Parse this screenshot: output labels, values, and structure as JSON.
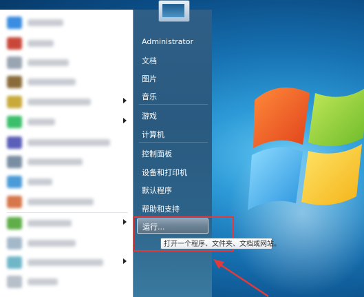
{
  "right_menu": {
    "user_name": "Administrator",
    "items": [
      "文档",
      "图片",
      "音乐",
      "游戏",
      "计算机",
      "控制面板",
      "设备和打印机",
      "默认程序",
      "帮助和支持"
    ],
    "run_label": "运行..."
  },
  "tooltip": "打开一个程序、文件夹、文档或网站。",
  "programs": {
    "icons": [
      "blurred-app-icon"
    ],
    "submenu_arrows": 4
  },
  "colors": {
    "highlight_box": "#e23a3a",
    "right_pane": "#2d5d84",
    "left_pane": "#ffffff"
  }
}
